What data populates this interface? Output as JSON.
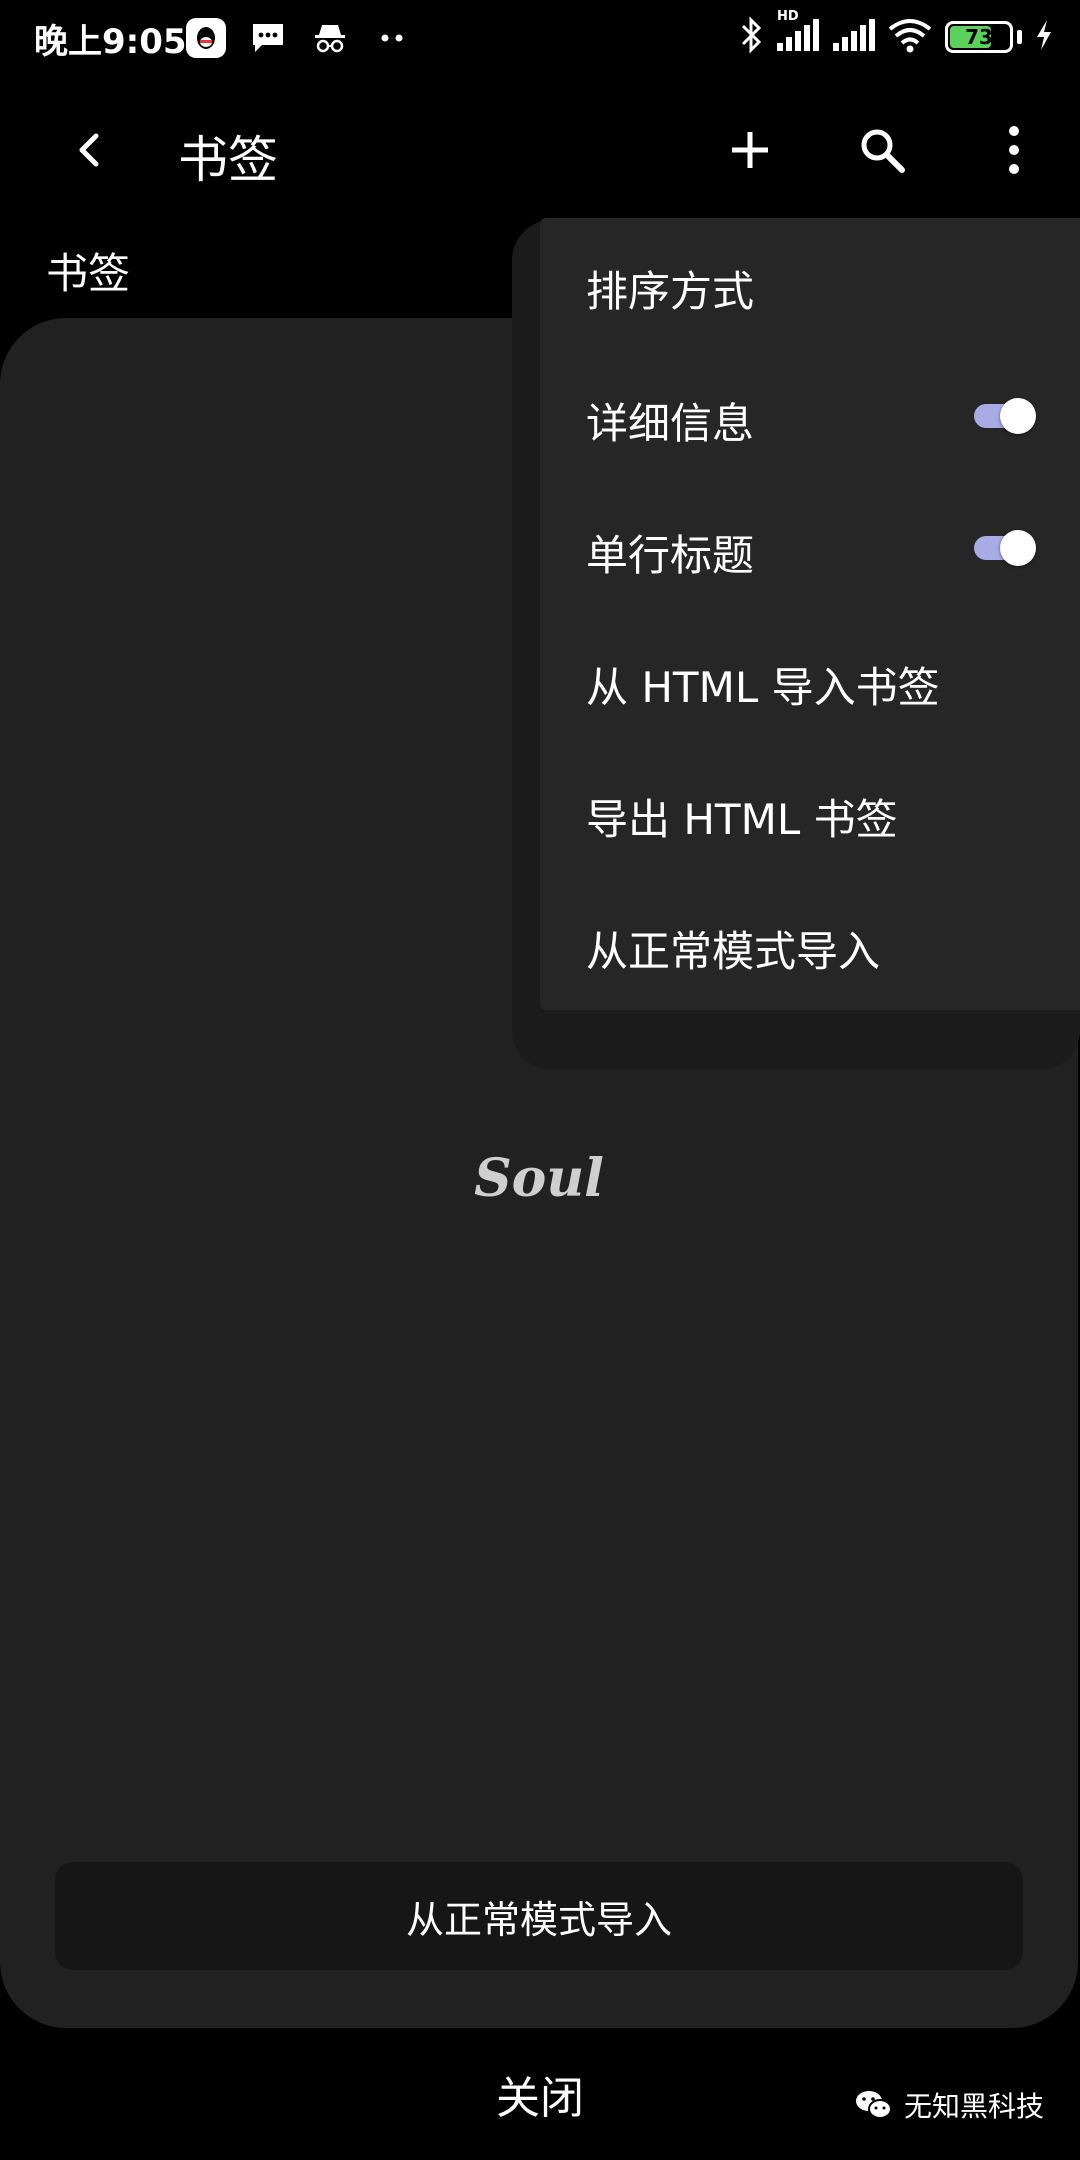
{
  "status_bar": {
    "time": "晚上9:05",
    "battery_level": "73",
    "battery_fraction": 0.73,
    "network_label": "HD",
    "icons": [
      "qq-icon",
      "message-icon",
      "incognito-icon",
      "more-dots-icon",
      "bluetooth-icon",
      "signal-icon",
      "wifi-icon",
      "battery-icon",
      "charging-icon"
    ]
  },
  "app_bar": {
    "title": "书签",
    "icons": [
      "back-arrow-icon",
      "plus-icon",
      "search-icon",
      "more-vert-icon"
    ]
  },
  "section_label": "书签",
  "overflow_menu": {
    "items": [
      {
        "label": "排序方式"
      },
      {
        "label": "详细信息",
        "toggle_on": true
      },
      {
        "label": "单行标题",
        "toggle_on": true
      },
      {
        "label": "从 HTML 导入书签"
      },
      {
        "label": "导出 HTML 书签"
      },
      {
        "label": "从正常模式导入"
      }
    ]
  },
  "card": {
    "logo_text": "Soul",
    "import_button_label": "从正常模式导入"
  },
  "bottom": {
    "close_label": "关闭",
    "watermark": "无知黑科技"
  },
  "colors": {
    "background": "#000000",
    "card": "#212121",
    "menu": "#262626",
    "toggle_track": "#a9abe4",
    "fab": "#4a8ff0",
    "battery": "#5bd15b"
  }
}
